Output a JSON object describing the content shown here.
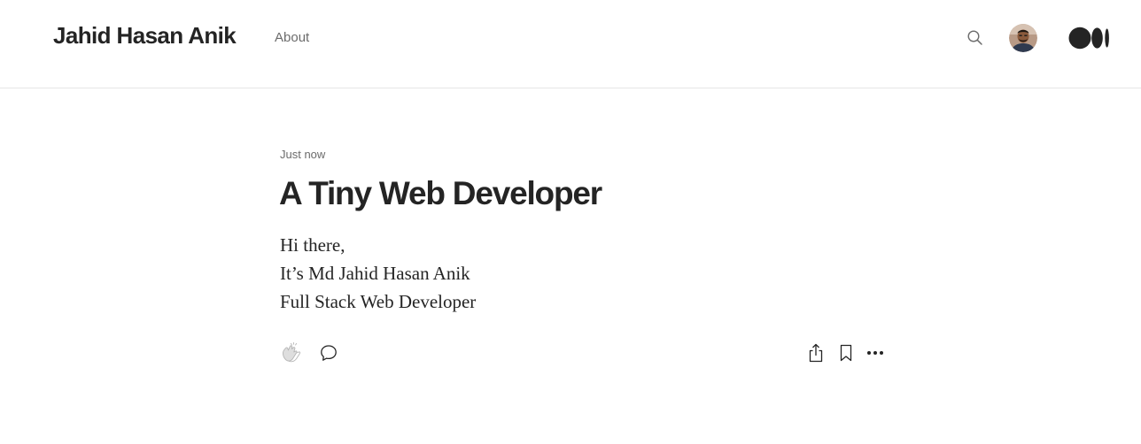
{
  "header": {
    "site_title": "Jahid Hasan Anik",
    "nav": {
      "about_label": "About"
    },
    "icons": {
      "search": "search-icon",
      "avatar": "user-avatar",
      "logo": "medium-logo"
    }
  },
  "article": {
    "timestamp": "Just now",
    "title": "A Tiny Web Developer",
    "paragraphs": [
      "Hi there,",
      "It’s Md Jahid Hasan Anik",
      "Full Stack Web Developer"
    ]
  },
  "actions": {
    "icons": [
      "clap-icon",
      "comment-icon",
      "share-icon",
      "bookmark-icon",
      "more-icon"
    ]
  },
  "colors": {
    "text": "#242424",
    "muted": "#6b6b6b",
    "divider": "#e6e6e6"
  }
}
